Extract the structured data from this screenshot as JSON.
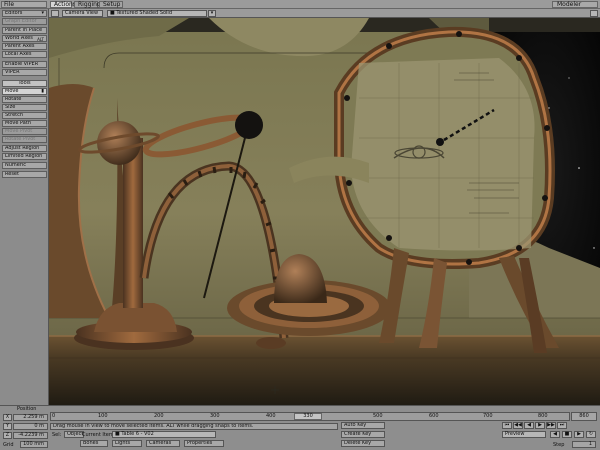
{
  "top": {
    "file_menu": "File",
    "tabs": [
      "Actions",
      "Rigging",
      "Setup"
    ],
    "modeler": "Modeler"
  },
  "toolbar": {
    "editors": "Editors",
    "grayed1": "Graph Editor",
    "parent_in_place": "Parent in Place",
    "world_axes": "World Axes",
    "world_axes_value": "ALT",
    "parent_axes": "Parent Axes",
    "local_axes": "Local Axes",
    "enable_viper": "Enable VIPER",
    "viper": "VIPER",
    "tools_header": "Tools",
    "move": "Move",
    "rotate": "Rotate",
    "size": "Size",
    "stretch": "Stretch",
    "move_path": "Move Path",
    "grayed2": "Move Pivot",
    "grayed3": "Rotate Pivot",
    "adjust_region": "Adjust Region",
    "limited_region": "Limited Region",
    "numeric": "Numeric",
    "reset": "Reset"
  },
  "viewport": {
    "view": "Camera View",
    "shading": "Textured Shaded Solid"
  },
  "bottom": {
    "position_label": "Position",
    "x_label": "X",
    "y_label": "Y",
    "z_label": "Z",
    "x_value": "2.259 m",
    "y_value": "0 m",
    "z_value": "-4.2239 m",
    "grid_label": "Grid",
    "grid_value": "100 mm",
    "timeline_ticks": [
      "0",
      "100",
      "200",
      "300",
      "400",
      "500",
      "600",
      "700",
      "800"
    ],
    "current_frame": "330",
    "end_frame": "860",
    "message": "Drag mouse in view to move selected items. ALT while dragging snaps to items.",
    "sel_label": "Sel:",
    "objects": "Objects",
    "bones": "Bones",
    "lights": "Lights",
    "cameras": "Cameras",
    "properties": "Properties",
    "current_item_label": "Current Item",
    "current_item": "Table 6 - V02",
    "auto_key": "Auto Key",
    "create_key": "Create Key",
    "delete_key": "Delete Key",
    "preview": "Preview",
    "step_label": "Step",
    "step_value": "1"
  }
}
